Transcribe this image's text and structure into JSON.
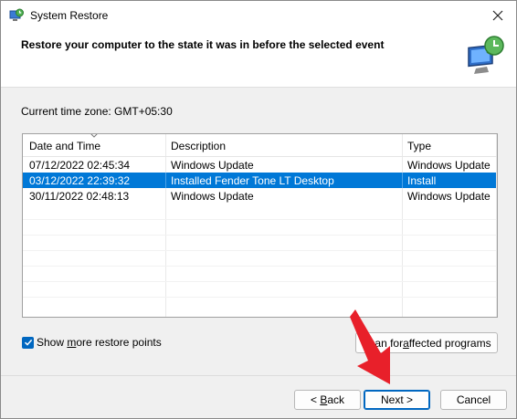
{
  "window": {
    "title": "System Restore",
    "close_glyph": "✕"
  },
  "header": {
    "title": "Restore your computer to the state it was in before the selected event",
    "art_icon": "system-restore-monitor-icon"
  },
  "timezone": "Current time zone: GMT+05:30",
  "table": {
    "columns": [
      "Date and Time",
      "Description",
      "Type"
    ],
    "rows": [
      {
        "date": "07/12/2022 02:45:34",
        "description": "Windows Update",
        "type": "Windows Update"
      },
      {
        "date": "03/12/2022 22:39:32",
        "description": "Installed Fender Tone LT Desktop",
        "type": "Install",
        "selected": true
      },
      {
        "date": "30/11/2022 02:48:13",
        "description": "Windows Update",
        "type": "Windows Update"
      }
    ]
  },
  "options": {
    "show_more_pre": "Show ",
    "show_more_key": "m",
    "show_more_post": "ore restore points",
    "show_more_checked": true,
    "scan_pre": "Scan for ",
    "scan_key": "a",
    "scan_post": "ffected programs"
  },
  "buttons": {
    "back_pre": "< ",
    "back_key": "B",
    "back_post": "ack",
    "next": "Next >",
    "cancel": "Cancel"
  },
  "colors": {
    "selection": "#0078d7",
    "accent": "#0067c0",
    "annotation_arrow": "#e8202a"
  }
}
